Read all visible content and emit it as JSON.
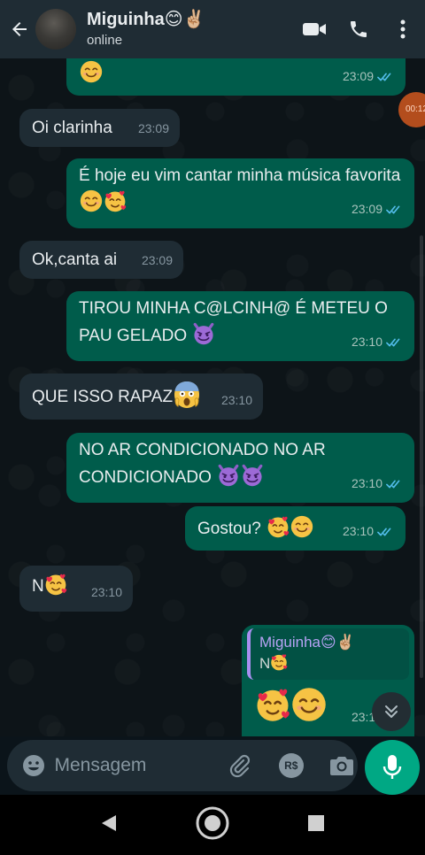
{
  "header": {
    "contact_name": "Miguinha😊✌🏼",
    "status": "online",
    "icons": [
      "back-arrow-icon",
      "video-call-icon",
      "phone-icon",
      "more-options-icon"
    ]
  },
  "messages": [
    {
      "dir": "out",
      "text": "",
      "emojis": [
        "smile"
      ],
      "time": "23:09",
      "read": true
    },
    {
      "dir": "in",
      "text": "Oi clarinha",
      "time": "23:09"
    },
    {
      "dir": "out",
      "text": "É hoje eu vim cantar minha música favorita",
      "emojis": [
        "smile",
        "hearts"
      ],
      "time": "23:09",
      "read": true
    },
    {
      "dir": "in",
      "text": "Ok,canta ai",
      "time": "23:09"
    },
    {
      "dir": "out",
      "text": "TIROU MINHA C@LCINH@ É METEU O PAU GELADO",
      "emojis": [
        "devil"
      ],
      "time": "23:10",
      "read": true
    },
    {
      "dir": "in",
      "text": "QUE ISSO RAPAZ",
      "emojis": [
        "scream"
      ],
      "time": "23:10"
    },
    {
      "dir": "out",
      "text": "NO AR CONDICIONADO NO AR CONDICIONADO",
      "emojis": [
        "devil",
        "devil"
      ],
      "time": "23:10",
      "read": true
    },
    {
      "dir": "out",
      "text": "Gostou?",
      "emojis": [
        "hearts",
        "smile"
      ],
      "time": "23:10",
      "read": true
    },
    {
      "dir": "in",
      "text": "N",
      "emojis": [
        "hearts"
      ],
      "time": "23:10"
    },
    {
      "dir": "out",
      "quote_name": "Miguinha😊✌🏼",
      "quote_text": "N",
      "text": "",
      "emojis": [
        "hearts",
        "smile"
      ],
      "time": "23:10",
      "read": true
    }
  ],
  "floating_video": {
    "time": "00:12"
  },
  "composer": {
    "placeholder": "Mensagem",
    "currency_label": "R$",
    "icons": [
      "emoji-icon",
      "attach-icon",
      "payment-icon",
      "camera-icon",
      "microphone-icon"
    ]
  },
  "colors": {
    "outgoing_bubble": "#005c4b",
    "incoming_bubble": "#1f2c34",
    "accent": "#00a884",
    "read_ticks": "#53bdeb"
  }
}
